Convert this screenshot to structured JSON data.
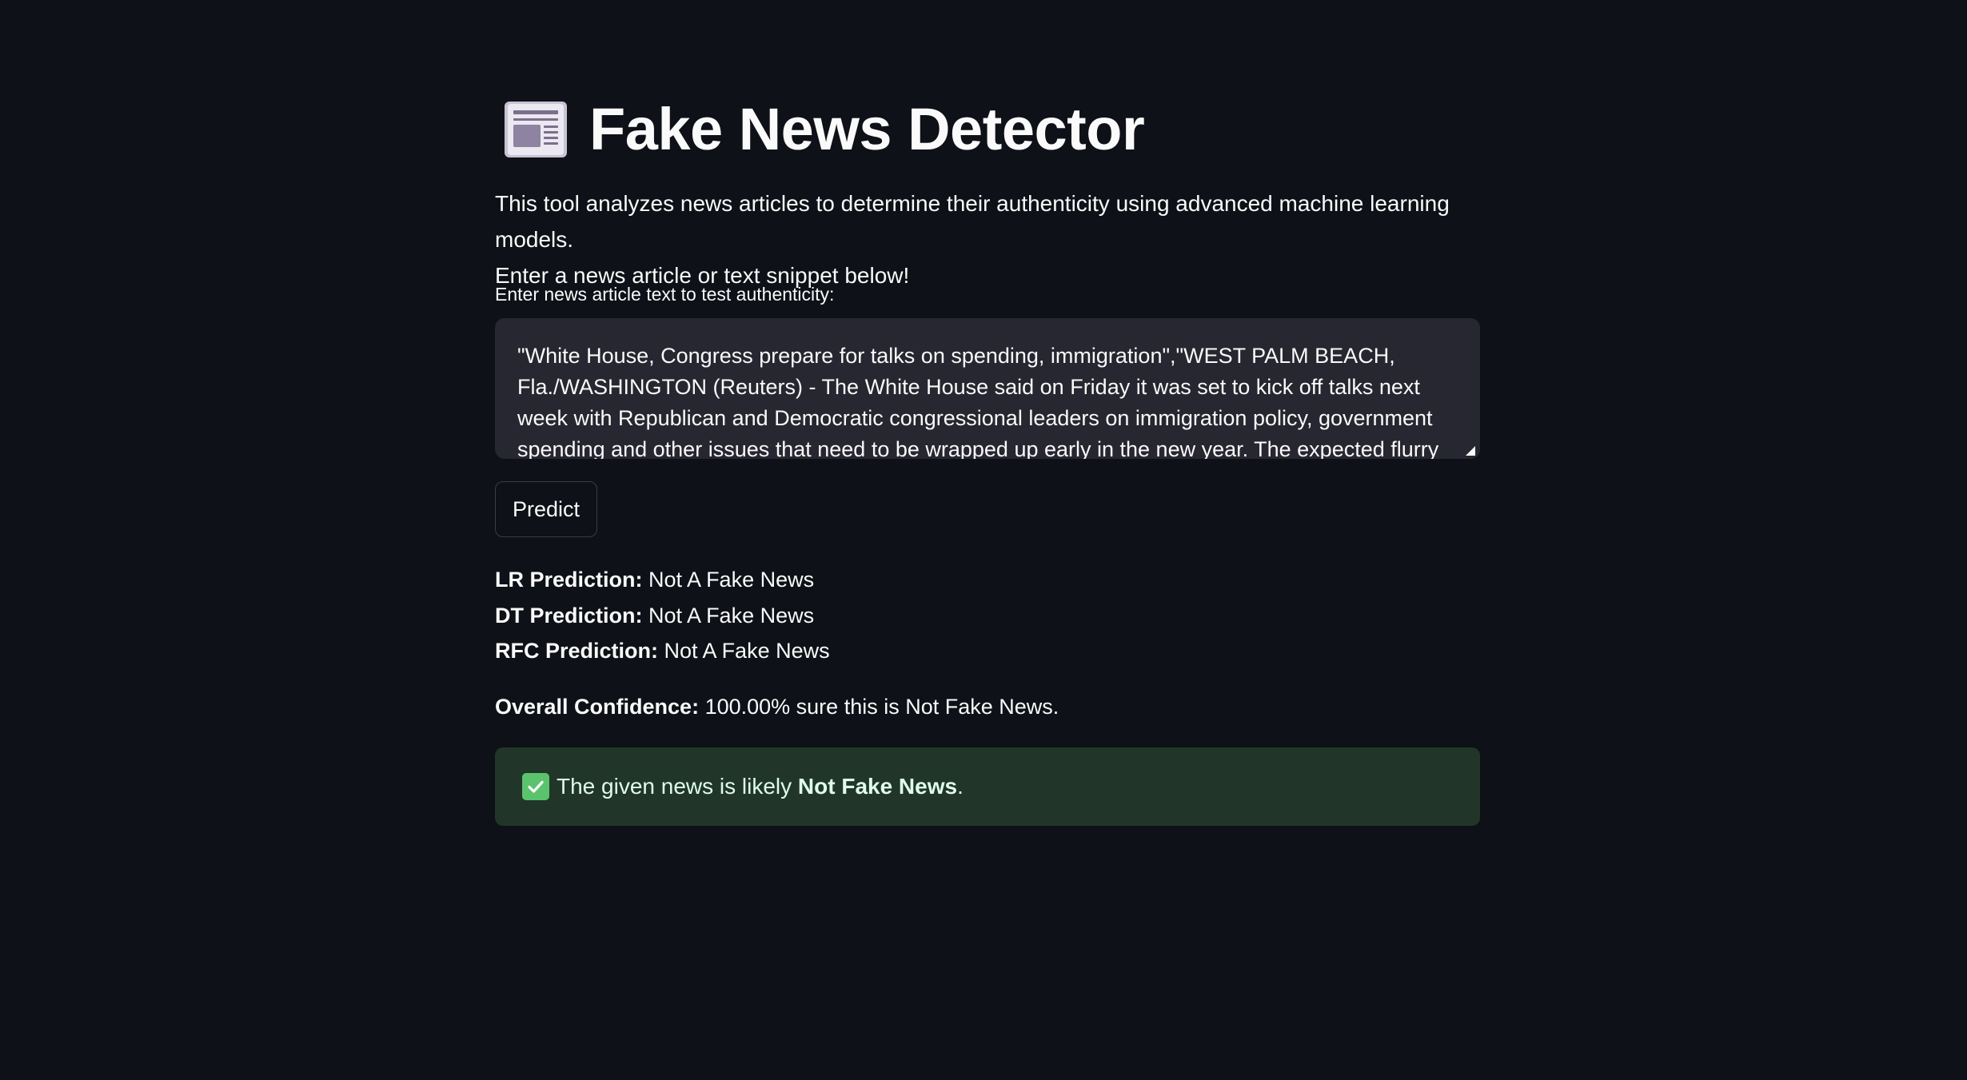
{
  "header": {
    "icon": "newspaper-icon",
    "title": "Fake News Detector"
  },
  "intro": {
    "line1": "This tool analyzes news articles to determine their authenticity using advanced machine learning models.",
    "line2": "Enter a news article or text snippet below!"
  },
  "input": {
    "label": "Enter news article text to test authenticity:",
    "value": "\"White House, Congress prepare for talks on spending, immigration\",\"WEST PALM BEACH, Fla./WASHINGTON (Reuters) - The White House said on Friday it was set to kick off talks next week with Republican and Democratic congressional leaders on immigration policy, government spending and other issues that need to be wrapped up early in the new year. The expected flurry of"
  },
  "predict_button": {
    "label": "Predict"
  },
  "results": {
    "lr_label": "LR Prediction:",
    "lr_value": " Not A Fake News",
    "dt_label": "DT Prediction:",
    "dt_value": " Not A Fake News",
    "rfc_label": "RFC Prediction:",
    "rfc_value": " Not A Fake News"
  },
  "confidence": {
    "label": "Overall Confidence:",
    "value": " 100.00% sure this is Not Fake News."
  },
  "alert": {
    "icon": "check-mark-icon",
    "prefix": "The given news is likely ",
    "verdict": "Not Fake News",
    "suffix": ".",
    "background": "#213628",
    "check_color": "#5bc36d"
  },
  "colors": {
    "background": "#0e1117",
    "text": "#fafafa",
    "input_background": "#262730"
  }
}
